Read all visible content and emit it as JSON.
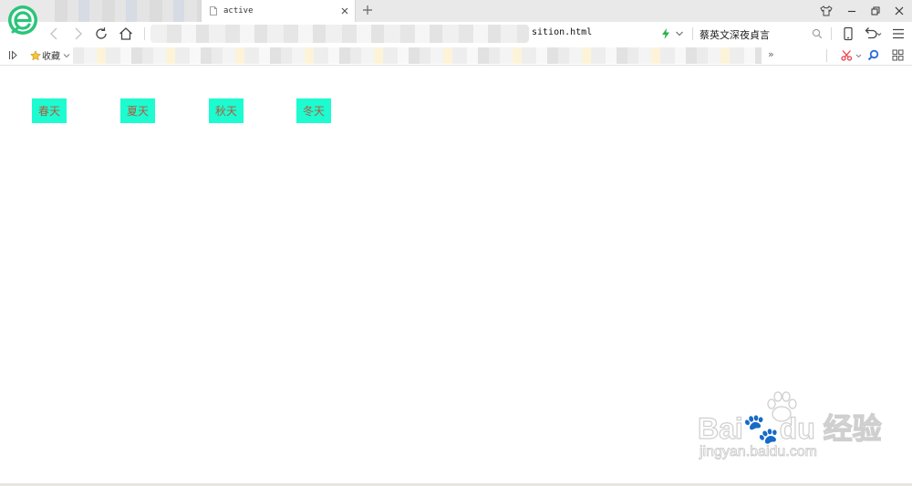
{
  "tab": {
    "title": "active",
    "close_label": "close tab",
    "new_tab_label": "new tab"
  },
  "address": {
    "url_visible": "sition.html"
  },
  "search": {
    "value": "蔡英文深夜貞言"
  },
  "bookmarks": {
    "favorites_label": "收藏",
    "more_label": "»"
  },
  "seasons": [
    "春天",
    "夏天",
    "秋天",
    "冬天"
  ],
  "colors": {
    "season_bg": "#1dfbd0",
    "season_text": "#b15a3a",
    "logo_green": "#2bc47a",
    "bolt_green": "#2ab24a",
    "scissors_red": "#e8434b",
    "magnifier_blue": "#2a6be0"
  },
  "watermark": {
    "brand": "Bai🐾du 经验",
    "url": "jingyan.baidu.com"
  },
  "icons": [
    "browser-logo-icon",
    "page-icon",
    "close-icon",
    "plus-icon",
    "tshirt-icon",
    "minimize-icon",
    "restore-icon",
    "back-icon",
    "forward-icon",
    "reload-icon",
    "home-icon",
    "bolt-icon",
    "chevron-down-icon",
    "search-icon",
    "mobile-icon",
    "undo-icon",
    "menu-icon",
    "sidebar-toggle-icon",
    "star-icon",
    "scissors-icon",
    "magnifier-icon",
    "apps-grid-icon"
  ]
}
